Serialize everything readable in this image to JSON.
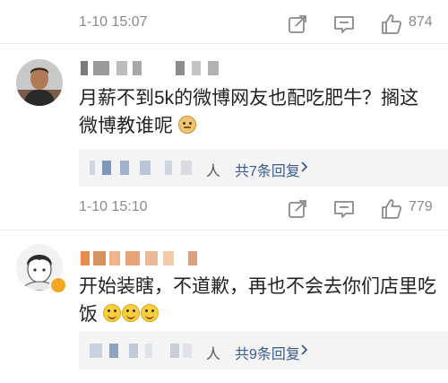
{
  "comment1": {
    "time": "1-10 15:07",
    "like_count": "874",
    "icons": [
      "share-icon",
      "comment-icon",
      "like-icon"
    ]
  },
  "comment2": {
    "text": "月薪不到5k的微博网友也配吃肥牛？搁这微博教谁呢",
    "emoji": "doge-emoji",
    "replies_tail": "人",
    "replies_link": "共7条回复",
    "time": "1-10 15:10",
    "like_count": "779",
    "icons": [
      "share-icon",
      "comment-icon",
      "like-icon"
    ]
  },
  "comment3": {
    "text": "开始装瞎，不道歉，再也不会去你们店里吃饭",
    "emoji": "smile-emoji",
    "emoji_count": 3,
    "replies_tail": "人",
    "replies_link": "共9条回复"
  },
  "colors": {
    "link": "#3a5b8c",
    "meta_text": "#8a8a8a",
    "reply_bg": "#f4f4f4",
    "verified_badge": "#f5a623"
  }
}
